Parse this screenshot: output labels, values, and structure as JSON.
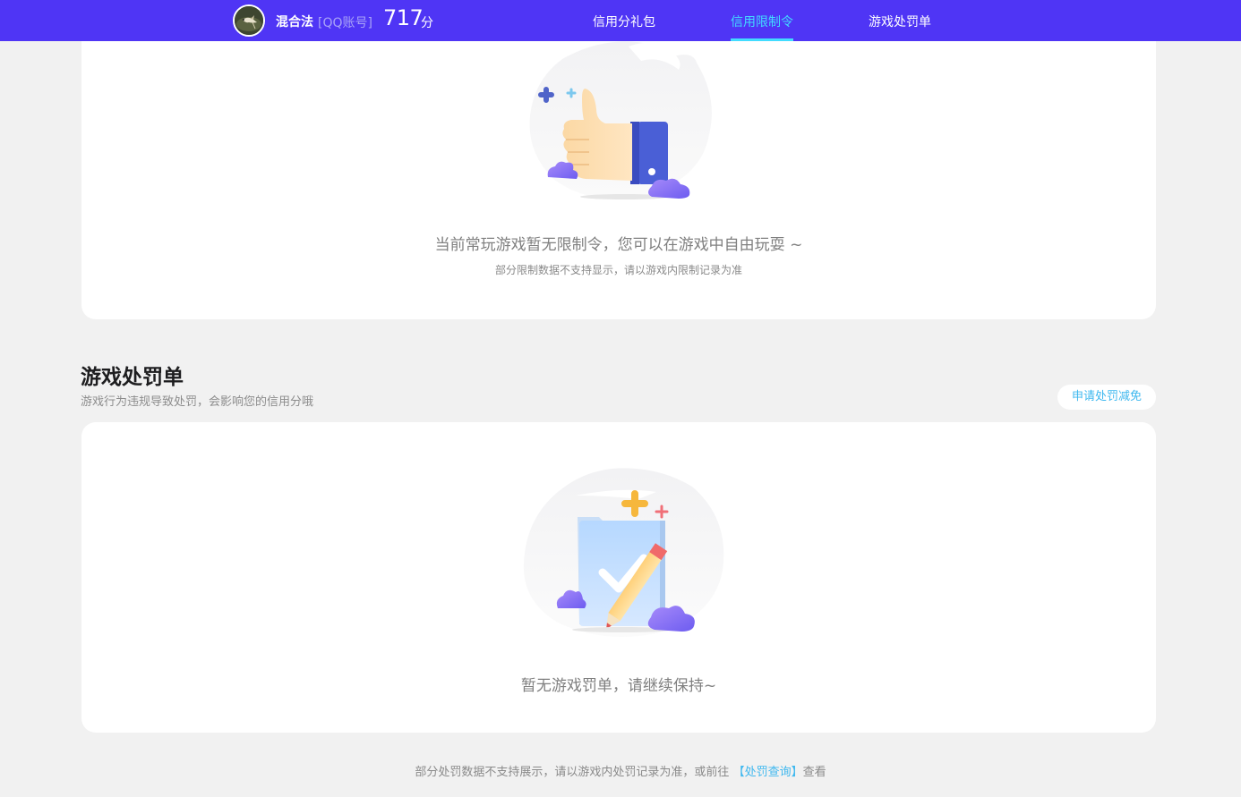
{
  "header": {
    "user_name": "混合法",
    "account_type": "[QQ账号]",
    "score": "717",
    "score_unit": "分",
    "tabs": [
      {
        "label": "信用分礼包",
        "active": false
      },
      {
        "label": "信用限制令",
        "active": true
      },
      {
        "label": "游戏处罚单",
        "active": false
      }
    ],
    "brand_color": "#4f35f5",
    "active_color": "#42dcff"
  },
  "restriction": {
    "empty_message": "当前常玩游戏暂无限制令，您可以在游戏中自由玩耍 ~",
    "empty_note": "部分限制数据不支持显示，请以游戏内限制记录为准",
    "illustration_icon": "thumbs-up-icon"
  },
  "penalty": {
    "title": "游戏处罚单",
    "description": "游戏行为违规导致处罚，会影响您的信用分哦",
    "apply_button": "申请处罚减免",
    "empty_message": "暂无游戏罚单，请继续保持~",
    "illustration_icon": "checklist-pencil-icon"
  },
  "footer": {
    "text_before": "部分处罚数据不支持展示，请以游戏内处罚记录为准，或前往",
    "link_text": "【处罚查询】",
    "text_after": "查看",
    "link_color": "#3fb8ef"
  }
}
